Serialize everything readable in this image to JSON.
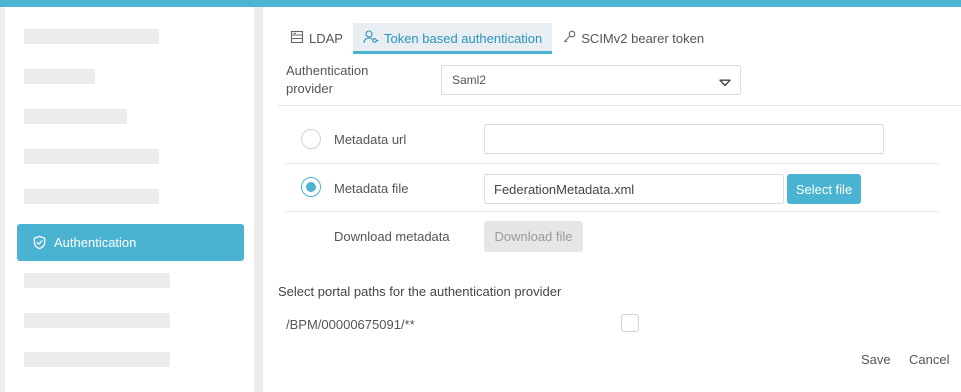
{
  "sidebar": {
    "active_item": {
      "label": "Authentication",
      "icon": "shield-check-icon"
    }
  },
  "tabs": [
    {
      "label": "LDAP",
      "icon": "server-icon",
      "active": false
    },
    {
      "label": "Token based authentication",
      "icon": "user-key-icon",
      "active": true
    },
    {
      "label": "SCIMv2 bearer token",
      "icon": "key-icon",
      "active": false
    }
  ],
  "form": {
    "provider_label": "Authentication provider",
    "provider_value": "Saml2",
    "metadata_url": {
      "label": "Metadata url",
      "value": "",
      "selected": false
    },
    "metadata_file": {
      "label": "Metadata file",
      "value": "FederationMetadata.xml",
      "selected": true,
      "button": "Select file"
    },
    "download": {
      "label": "Download metadata",
      "button": "Download file"
    }
  },
  "portal_paths": {
    "title": "Select portal paths for the authentication provider",
    "paths": [
      {
        "path": "/BPM/00000675091/**",
        "checked": false
      }
    ]
  },
  "actions": {
    "save": "Save",
    "cancel": "Cancel"
  },
  "colors": {
    "accent": "#4ab3d2",
    "top_bar": "#4fb3d3"
  }
}
